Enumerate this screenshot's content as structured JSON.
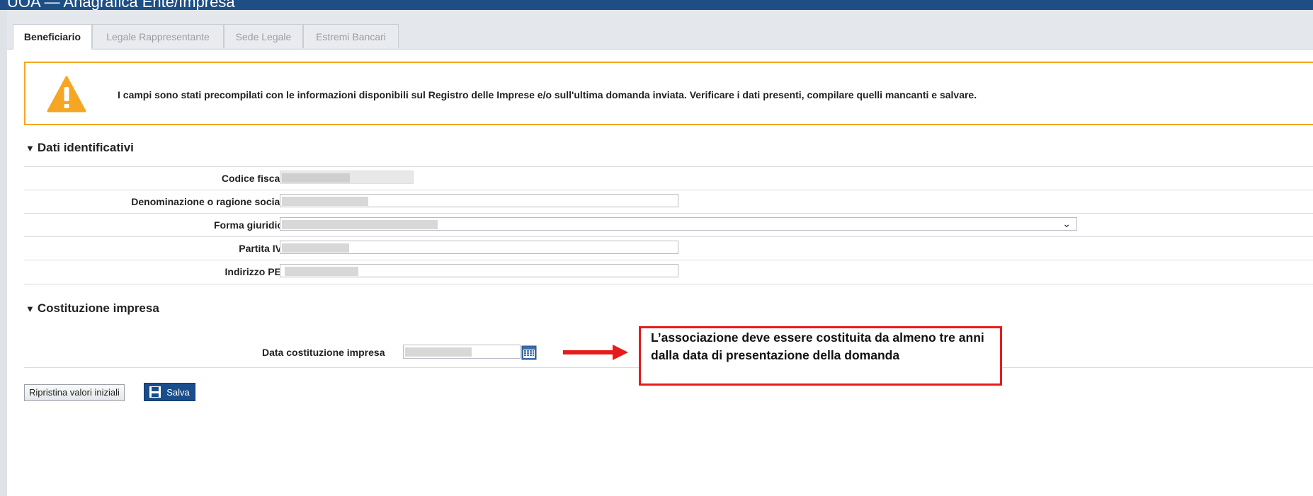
{
  "header": {
    "title": "UOA — Anagrafica Ente/Impresa"
  },
  "tabs": [
    {
      "label": "Beneficiario",
      "active": true
    },
    {
      "label": "Legale Rappresentante",
      "active": false
    },
    {
      "label": "Sede Legale",
      "active": false
    },
    {
      "label": "Estremi Bancari",
      "active": false
    }
  ],
  "warning": {
    "icon": "warning-icon",
    "text": "I campi sono stati precompilati con le informazioni disponibili sul Registro delle Imprese e/o sull'ultima domanda inviata. Verificare i dati presenti, compilare quelli mancanti e salvare."
  },
  "sections": {
    "identificativi": {
      "title": "Dati identificativi",
      "fields": {
        "codice_fiscale": {
          "label": "Codice fiscale"
        },
        "denominazione": {
          "label": "Denominazione o ragione sociale"
        },
        "forma_giuridica": {
          "label": "Forma giuridica"
        },
        "partita_iva": {
          "label": "Partita IVA"
        },
        "pec": {
          "label": "Indirizzo PEC"
        }
      }
    },
    "costituzione": {
      "title": "Costituzione impresa",
      "fields": {
        "data_costituzione": {
          "label": "Data costituzione impresa"
        }
      }
    }
  },
  "buttons": {
    "reset_label": "Ripristina valori iniziali",
    "save_label": "Salva"
  },
  "annotation": {
    "text": "L’associazione deve essere costituita da almeno tre anni dalla data di presentazione della domanda"
  },
  "colors": {
    "header_blue": "#1d4f86",
    "warning_orange": "#f5a623",
    "annotation_red": "#e61c1c"
  }
}
